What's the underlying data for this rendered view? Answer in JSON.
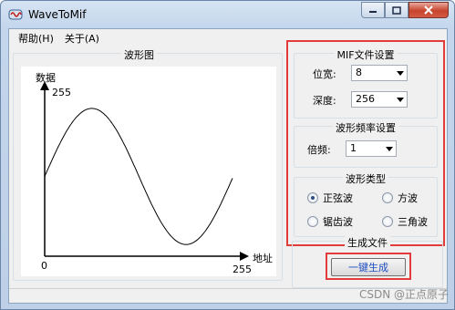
{
  "window": {
    "title": "WaveToMif"
  },
  "menu": {
    "items": [
      "帮助(H)",
      "关于(A)"
    ]
  },
  "waveform": {
    "group_title": "波形图",
    "y_axis_label": "数据",
    "x_axis_label": "地址",
    "y_max_label": "255",
    "origin_label": "0",
    "x_max_label": "255"
  },
  "chart_data": {
    "type": "line",
    "x_range": [
      0,
      255
    ],
    "y_range": [
      0,
      255
    ],
    "grid": false
  },
  "mif_settings": {
    "title": "MIF文件设置",
    "width_label": "位宽:",
    "width_value": "8",
    "depth_label": "深度:",
    "depth_value": "256"
  },
  "freq_settings": {
    "title": "波形频率设置",
    "multiplier_label": "倍频:",
    "multiplier_value": "1"
  },
  "wave_type": {
    "title": "波形类型",
    "options": [
      "正弦波",
      "方波",
      "锯齿波",
      "三角波"
    ],
    "selected": "正弦波"
  },
  "generate": {
    "title": "生成文件",
    "button_label": "一键生成"
  },
  "watermark": "CSDN @正点原子"
}
